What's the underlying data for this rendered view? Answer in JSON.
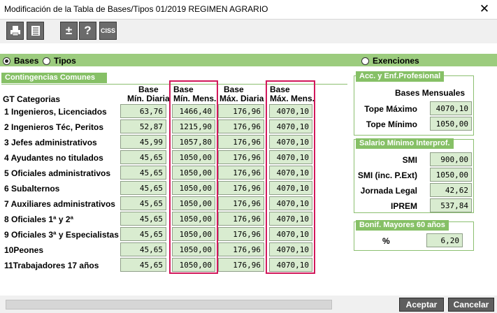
{
  "window": {
    "title": "Modificación de la Tabla de Bases/Tipos 01/2019 REGIMEN AGRARIO",
    "close_glyph": "✕"
  },
  "toolbar": {
    "ciss_label": "CISS",
    "plusminus_label": "±",
    "help_label": "?"
  },
  "radios": {
    "bases": "Bases",
    "tipos": "Tipos",
    "exenciones": "Exenciones"
  },
  "contingencias": {
    "header": "Contingencias Comunes",
    "col_gt": "GT Categorias",
    "col_min_diaria": [
      "Base",
      "Mín. Diaria"
    ],
    "col_min_mens": [
      "Base",
      "Mín. Mens."
    ],
    "col_max_diaria": [
      "Base",
      "Máx. Diaria"
    ],
    "col_max_mens": [
      "Base",
      "Máx. Mens."
    ],
    "rows": [
      {
        "label": "1  Ingenieros, Licenciados",
        "min_diaria": "63,76",
        "min_mens": "1466,40",
        "max_diaria": "176,96",
        "max_mens": "4070,10"
      },
      {
        "label": "2 Ingenieros Téc, Peritos",
        "min_diaria": "52,87",
        "min_mens": "1215,90",
        "max_diaria": "176,96",
        "max_mens": "4070,10"
      },
      {
        "label": "3 Jefes administrativos",
        "min_diaria": "45,99",
        "min_mens": "1057,80",
        "max_diaria": "176,96",
        "max_mens": "4070,10"
      },
      {
        "label": "4 Ayudantes no titulados",
        "min_diaria": "45,65",
        "min_mens": "1050,00",
        "max_diaria": "176,96",
        "max_mens": "4070,10"
      },
      {
        "label": "5  Oficiales administrativos",
        "min_diaria": "45,65",
        "min_mens": "1050,00",
        "max_diaria": "176,96",
        "max_mens": "4070,10"
      },
      {
        "label": "6 Subalternos",
        "min_diaria": "45,65",
        "min_mens": "1050,00",
        "max_diaria": "176,96",
        "max_mens": "4070,10"
      },
      {
        "label": "7  Auxiliares administrativos",
        "min_diaria": "45,65",
        "min_mens": "1050,00",
        "max_diaria": "176,96",
        "max_mens": "4070,10"
      },
      {
        "label": "8 Oficiales 1ª y 2ª",
        "min_diaria": "45,65",
        "min_mens": "1050,00",
        "max_diaria": "176,96",
        "max_mens": "4070,10"
      },
      {
        "label": "9 Oficiales 3ª y Especialistas",
        "min_diaria": "45,65",
        "min_mens": "1050,00",
        "max_diaria": "176,96",
        "max_mens": "4070,10"
      },
      {
        "label": "10Peones",
        "min_diaria": "45,65",
        "min_mens": "1050,00",
        "max_diaria": "176,96",
        "max_mens": "4070,10"
      },
      {
        "label": "11Trabajadores 17 años",
        "min_diaria": "45,65",
        "min_mens": "1050,00",
        "max_diaria": "176,96",
        "max_mens": "4070,10"
      }
    ]
  },
  "acc": {
    "header": "Acc. y Enf.Profesional",
    "subtitle": "Bases Mensuales",
    "tope_max_label": "Tope Máximo",
    "tope_max": "4070,10",
    "tope_min_label": "Tope Mínimo",
    "tope_min": "1050,00"
  },
  "smi": {
    "header": "Salario Mínimo Interprof.",
    "smi_label": "SMI",
    "smi": "900,00",
    "smi_ext_label": "SMI (inc. P.Ext)",
    "smi_ext": "1050,00",
    "jornada_label": "Jornada Legal",
    "jornada": "42,62",
    "iprem_label": "IPREM",
    "iprem": "537,84"
  },
  "bonif": {
    "header": "Bonif. Mayores 60 años",
    "pct_label": "%",
    "pct": "6,20"
  },
  "footer": {
    "aceptar": "Aceptar",
    "cancelar": "Cancelar"
  }
}
